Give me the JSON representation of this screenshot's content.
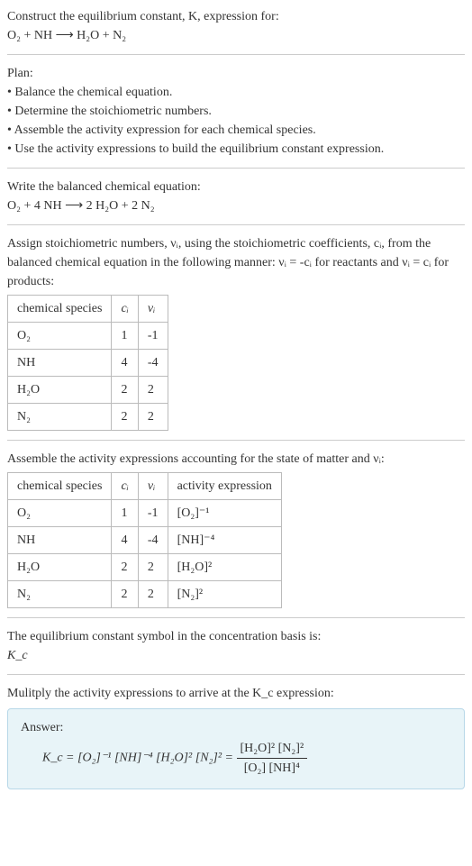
{
  "intro": {
    "line1": "Construct the equilibrium constant, K, expression for:",
    "eqn": "O₂ + NH ⟶ H₂O + N₂"
  },
  "plan": {
    "heading": "Plan:",
    "items": [
      "• Balance the chemical equation.",
      "• Determine the stoichiometric numbers.",
      "• Assemble the activity expression for each chemical species.",
      "• Use the activity expressions to build the equilibrium constant expression."
    ]
  },
  "balanced": {
    "heading": "Write the balanced chemical equation:",
    "eqn": "O₂ + 4 NH ⟶ 2 H₂O + 2 N₂"
  },
  "stoich": {
    "text1": "Assign stoichiometric numbers, νᵢ, using the stoichiometric coefficients, cᵢ, from the balanced chemical equation in the following manner: νᵢ = -cᵢ for reactants and νᵢ = cᵢ for products:",
    "headers": [
      "chemical species",
      "cᵢ",
      "νᵢ"
    ],
    "rows": [
      [
        "O₂",
        "1",
        "-1"
      ],
      [
        "NH",
        "4",
        "-4"
      ],
      [
        "H₂O",
        "2",
        "2"
      ],
      [
        "N₂",
        "2",
        "2"
      ]
    ]
  },
  "activity": {
    "text": "Assemble the activity expressions accounting for the state of matter and νᵢ:",
    "headers": [
      "chemical species",
      "cᵢ",
      "νᵢ",
      "activity expression"
    ],
    "rows": [
      [
        "O₂",
        "1",
        "-1",
        "[O₂]⁻¹"
      ],
      [
        "NH",
        "4",
        "-4",
        "[NH]⁻⁴"
      ],
      [
        "H₂O",
        "2",
        "2",
        "[H₂O]²"
      ],
      [
        "N₂",
        "2",
        "2",
        "[N₂]²"
      ]
    ]
  },
  "symbol": {
    "text": "The equilibrium constant symbol in the concentration basis is:",
    "val": "K_c"
  },
  "mult": {
    "text": "Mulitply the activity expressions to arrive at the K_c expression:"
  },
  "answer": {
    "label": "Answer:",
    "lhs": "K_c = [O₂]⁻¹ [NH]⁻⁴ [H₂O]² [N₂]² = ",
    "num": "[H₂O]² [N₂]²",
    "den": "[O₂] [NH]⁴"
  },
  "chart_data": {
    "type": "table",
    "tables": [
      {
        "title": "Stoichiometric numbers",
        "columns": [
          "chemical species",
          "c_i",
          "nu_i"
        ],
        "rows": [
          {
            "chemical species": "O2",
            "c_i": 1,
            "nu_i": -1
          },
          {
            "chemical species": "NH",
            "c_i": 4,
            "nu_i": -4
          },
          {
            "chemical species": "H2O",
            "c_i": 2,
            "nu_i": 2
          },
          {
            "chemical species": "N2",
            "c_i": 2,
            "nu_i": 2
          }
        ]
      },
      {
        "title": "Activity expressions",
        "columns": [
          "chemical species",
          "c_i",
          "nu_i",
          "activity expression"
        ],
        "rows": [
          {
            "chemical species": "O2",
            "c_i": 1,
            "nu_i": -1,
            "activity expression": "[O2]^-1"
          },
          {
            "chemical species": "NH",
            "c_i": 4,
            "nu_i": -4,
            "activity expression": "[NH]^-4"
          },
          {
            "chemical species": "H2O",
            "c_i": 2,
            "nu_i": 2,
            "activity expression": "[H2O]^2"
          },
          {
            "chemical species": "N2",
            "c_i": 2,
            "nu_i": 2,
            "activity expression": "[N2]^2"
          }
        ]
      }
    ]
  }
}
